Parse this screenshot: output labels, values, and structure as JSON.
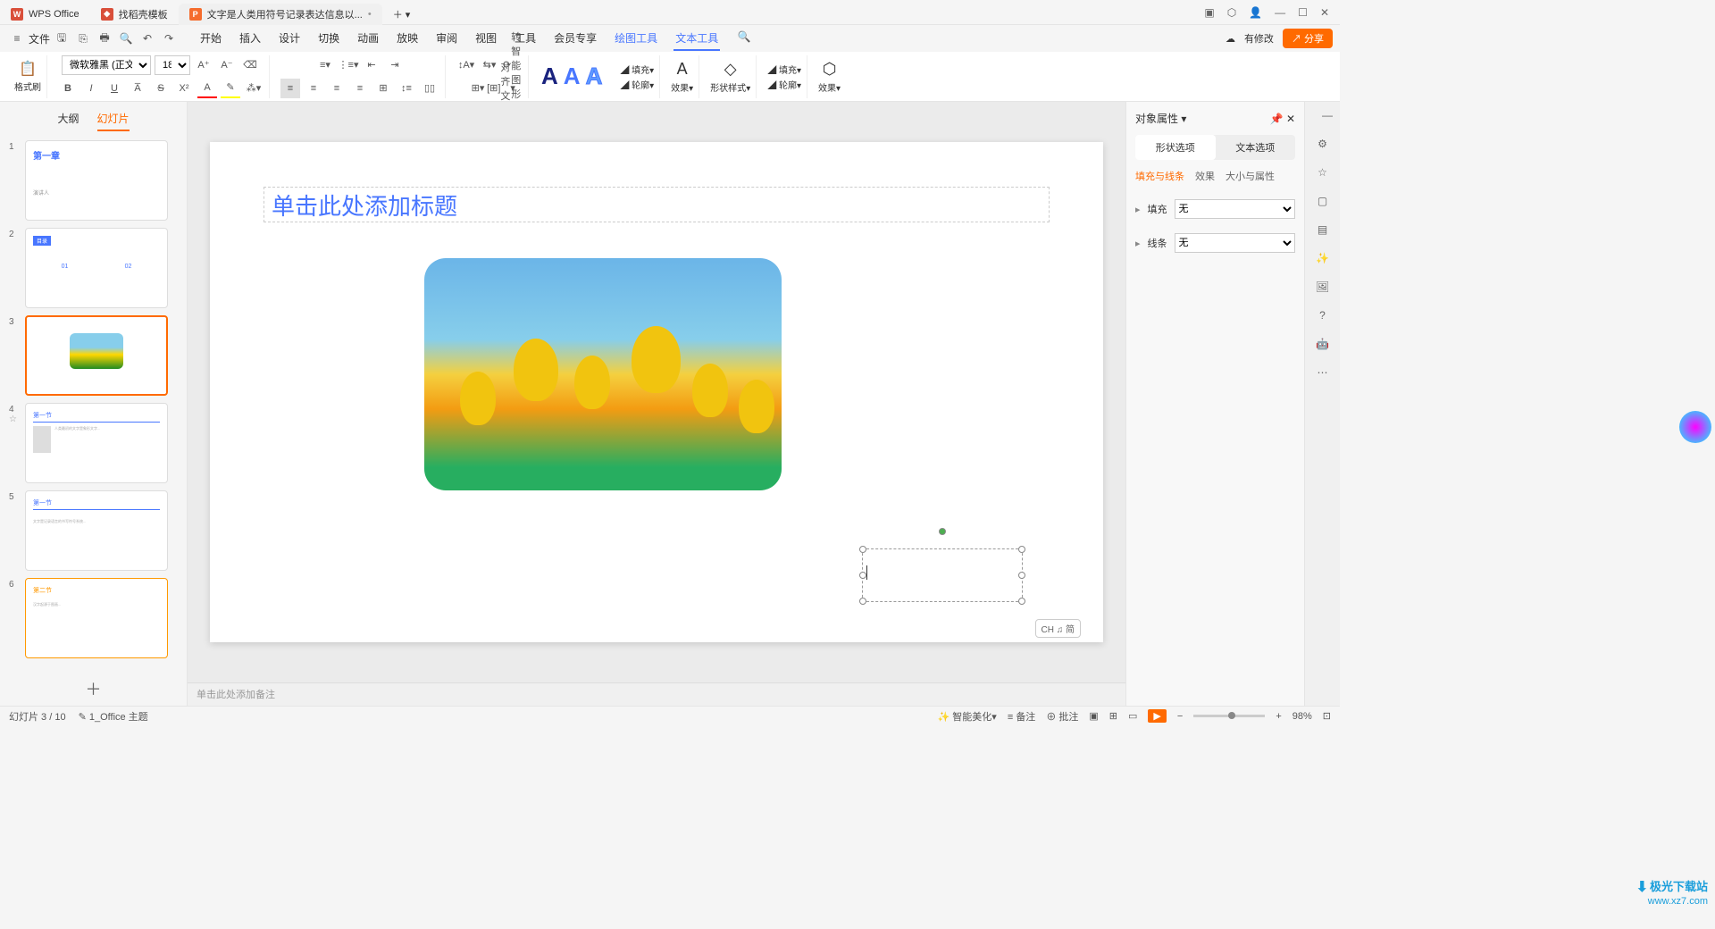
{
  "titlebar": {
    "app_name": "WPS Office",
    "tab2": "找稻壳模板",
    "tab3": "文字是人类用符号记录表达信息以..."
  },
  "menubar": {
    "file": "文件",
    "tabs": [
      "开始",
      "插入",
      "设计",
      "切换",
      "动画",
      "放映",
      "审阅",
      "视图",
      "工具",
      "会员专享",
      "绘图工具",
      "文本工具"
    ],
    "modified": "有修改",
    "share": "分享"
  },
  "ribbon": {
    "format_brush": "格式刷",
    "font_name": "微软雅黑 (正文)",
    "font_size": "18",
    "smart_shape": "转智能图形",
    "fill": "填充",
    "outline": "轮廓",
    "effect": "效果",
    "shape_style": "形状样式",
    "outline2": "轮廓",
    "effect2": "效果",
    "align_text": "对齐文本"
  },
  "left_panel": {
    "tab_outline": "大纲",
    "tab_slides": "幻灯片",
    "thumbs": [
      {
        "title": "第一章",
        "sub": "演讲人"
      },
      {
        "title": "目录",
        "sub": "01  02"
      },
      {
        "title": "",
        "sub": ""
      },
      {
        "title": "第一节",
        "sub": ""
      },
      {
        "title": "第一节",
        "sub": ""
      },
      {
        "title": "第二节",
        "sub": ""
      }
    ]
  },
  "slide": {
    "title_placeholder": "单击此处添加标题"
  },
  "notes": {
    "placeholder": "单击此处添加备注"
  },
  "right_panel": {
    "header": "对象属性",
    "tab_shape": "形状选项",
    "tab_text": "文本选项",
    "subtab_fill": "填充与线条",
    "subtab_effect": "效果",
    "subtab_size": "大小与属性",
    "prop_fill": "填充",
    "prop_line": "线条",
    "none": "无"
  },
  "statusbar": {
    "slide_count": "幻灯片 3 / 10",
    "theme": "1_Office 主题",
    "beautify": "智能美化",
    "notes": "备注",
    "comments": "批注",
    "zoom": "98%"
  },
  "ime": "CH ♫ 简",
  "watermark": {
    "line1": "极光下载站",
    "line2": "www.xz7.com"
  }
}
